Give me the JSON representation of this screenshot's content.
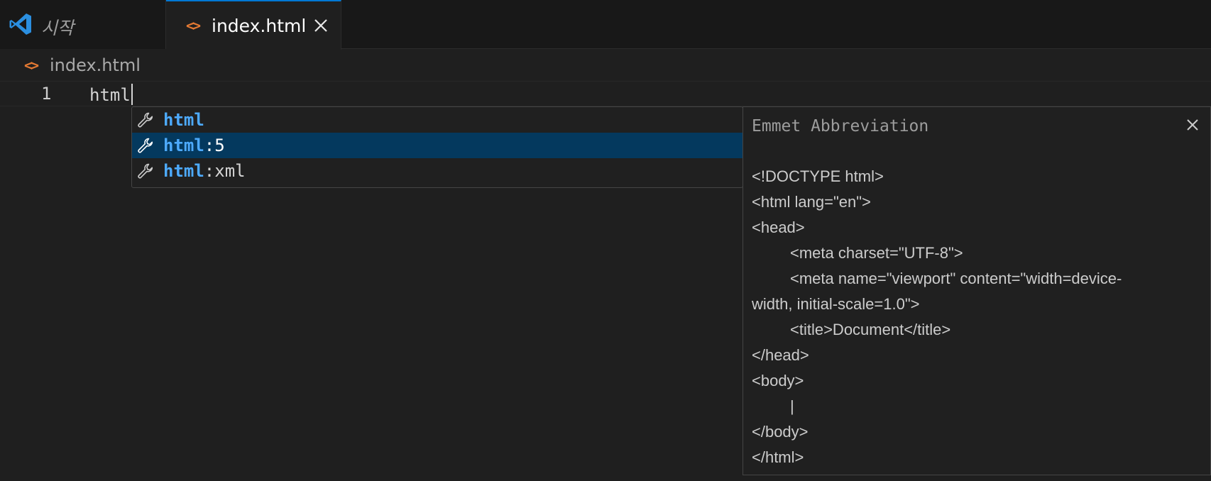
{
  "tabs": {
    "start": {
      "label": "시작",
      "icon": "vscode-logo-icon"
    },
    "active": {
      "label": "index.html",
      "icon": "html-file-icon",
      "close_icon": "close-icon"
    }
  },
  "breadcrumb": {
    "label": "index.html",
    "icon": "html-file-icon"
  },
  "editor": {
    "line_number": "1",
    "code": "html"
  },
  "suggestions": [
    {
      "match": "html",
      "rest": "",
      "icon": "wrench-icon",
      "selected": false
    },
    {
      "match": "html",
      "rest": ":5",
      "icon": "wrench-icon",
      "selected": true
    },
    {
      "match": "html",
      "rest": ":xml",
      "icon": "wrench-icon",
      "selected": false
    }
  ],
  "details": {
    "title": "Emmet Abbreviation",
    "lines": [
      "<!DOCTYPE html>",
      "<html lang=\"en\">",
      "<head>",
      "<meta charset=\"UTF-8\">",
      "<meta name=\"viewport\" content=\"width=device-",
      "width, initial-scale=1.0\">",
      "<title>Document</title>",
      "</head>",
      "<body>",
      "|",
      "</body>",
      "</html>"
    ]
  },
  "colors": {
    "background": "#1f1f1f",
    "accent": "#0078d4",
    "selection": "#04395e",
    "match_highlight": "#4daafc",
    "html_icon": "#e37933"
  }
}
